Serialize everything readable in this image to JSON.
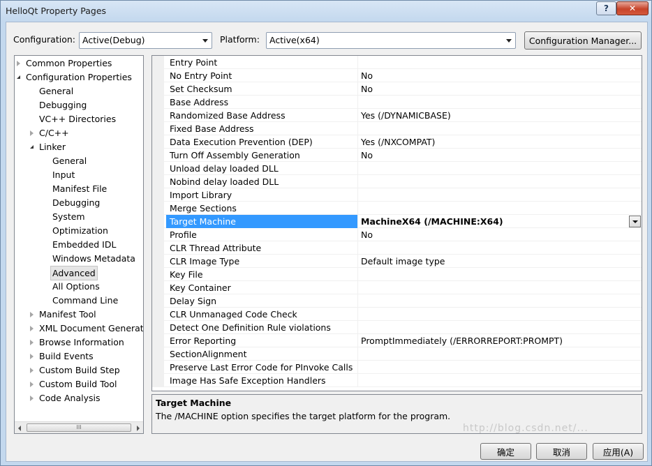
{
  "window": {
    "title": "HelloQt Property Pages",
    "help_label": "?",
    "close_label": "✕"
  },
  "config_bar": {
    "configuration_label": "Configuration:",
    "configuration_value": "Active(Debug)",
    "platform_label": "Platform:",
    "platform_value": "Active(x64)",
    "manager_button": "Configuration Manager..."
  },
  "tree": {
    "items": [
      {
        "label": "Common Properties",
        "level": 0,
        "expander": "collapsed"
      },
      {
        "label": "Configuration Properties",
        "level": 0,
        "expander": "expanded"
      },
      {
        "label": "General",
        "level": 1,
        "expander": "none"
      },
      {
        "label": "Debugging",
        "level": 1,
        "expander": "none"
      },
      {
        "label": "VC++ Directories",
        "level": 1,
        "expander": "none"
      },
      {
        "label": "C/C++",
        "level": 1,
        "expander": "collapsed"
      },
      {
        "label": "Linker",
        "level": 1,
        "expander": "expanded"
      },
      {
        "label": "General",
        "level": 2,
        "expander": "none"
      },
      {
        "label": "Input",
        "level": 2,
        "expander": "none"
      },
      {
        "label": "Manifest File",
        "level": 2,
        "expander": "none"
      },
      {
        "label": "Debugging",
        "level": 2,
        "expander": "none"
      },
      {
        "label": "System",
        "level": 2,
        "expander": "none"
      },
      {
        "label": "Optimization",
        "level": 2,
        "expander": "none"
      },
      {
        "label": "Embedded IDL",
        "level": 2,
        "expander": "none"
      },
      {
        "label": "Windows Metadata",
        "level": 2,
        "expander": "none"
      },
      {
        "label": "Advanced",
        "level": 2,
        "expander": "none",
        "selected": true
      },
      {
        "label": "All Options",
        "level": 2,
        "expander": "none"
      },
      {
        "label": "Command Line",
        "level": 2,
        "expander": "none"
      },
      {
        "label": "Manifest Tool",
        "level": 1,
        "expander": "collapsed"
      },
      {
        "label": "XML Document Generat",
        "level": 1,
        "expander": "collapsed"
      },
      {
        "label": "Browse Information",
        "level": 1,
        "expander": "collapsed"
      },
      {
        "label": "Build Events",
        "level": 1,
        "expander": "collapsed"
      },
      {
        "label": "Custom Build Step",
        "level": 1,
        "expander": "collapsed"
      },
      {
        "label": "Custom Build Tool",
        "level": 1,
        "expander": "collapsed"
      },
      {
        "label": "Code Analysis",
        "level": 1,
        "expander": "collapsed"
      }
    ]
  },
  "grid": {
    "rows": [
      {
        "name": "Entry Point",
        "value": ""
      },
      {
        "name": "No Entry Point",
        "value": "No"
      },
      {
        "name": "Set Checksum",
        "value": "No"
      },
      {
        "name": "Base Address",
        "value": ""
      },
      {
        "name": "Randomized Base Address",
        "value": "Yes (/DYNAMICBASE)"
      },
      {
        "name": "Fixed Base Address",
        "value": ""
      },
      {
        "name": "Data Execution Prevention (DEP)",
        "value": "Yes (/NXCOMPAT)"
      },
      {
        "name": "Turn Off Assembly Generation",
        "value": "No"
      },
      {
        "name": "Unload delay loaded DLL",
        "value": ""
      },
      {
        "name": "Nobind delay loaded DLL",
        "value": ""
      },
      {
        "name": "Import Library",
        "value": ""
      },
      {
        "name": "Merge Sections",
        "value": ""
      },
      {
        "name": "Target Machine",
        "value": "MachineX64 (/MACHINE:X64)",
        "selected": true
      },
      {
        "name": "Profile",
        "value": "No"
      },
      {
        "name": "CLR Thread Attribute",
        "value": ""
      },
      {
        "name": "CLR Image Type",
        "value": "Default image type"
      },
      {
        "name": "Key File",
        "value": ""
      },
      {
        "name": "Key Container",
        "value": ""
      },
      {
        "name": "Delay Sign",
        "value": ""
      },
      {
        "name": "CLR Unmanaged Code Check",
        "value": ""
      },
      {
        "name": "Detect One Definition Rule violations",
        "value": ""
      },
      {
        "name": "Error Reporting",
        "value": "PromptImmediately (/ERRORREPORT:PROMPT)"
      },
      {
        "name": "SectionAlignment",
        "value": ""
      },
      {
        "name": "Preserve Last Error Code for PInvoke Calls",
        "value": ""
      },
      {
        "name": "Image Has Safe Exception Handlers",
        "value": ""
      }
    ]
  },
  "description": {
    "title": "Target Machine",
    "text": "The /MACHINE option specifies the target platform for the program."
  },
  "scrollbar": {
    "thumb_grip": "III"
  },
  "footer": {
    "ok_label": "确定",
    "cancel_label": "取消",
    "apply_label": "应用(A)",
    "watermark": "http://blog.csdn.net/..."
  }
}
